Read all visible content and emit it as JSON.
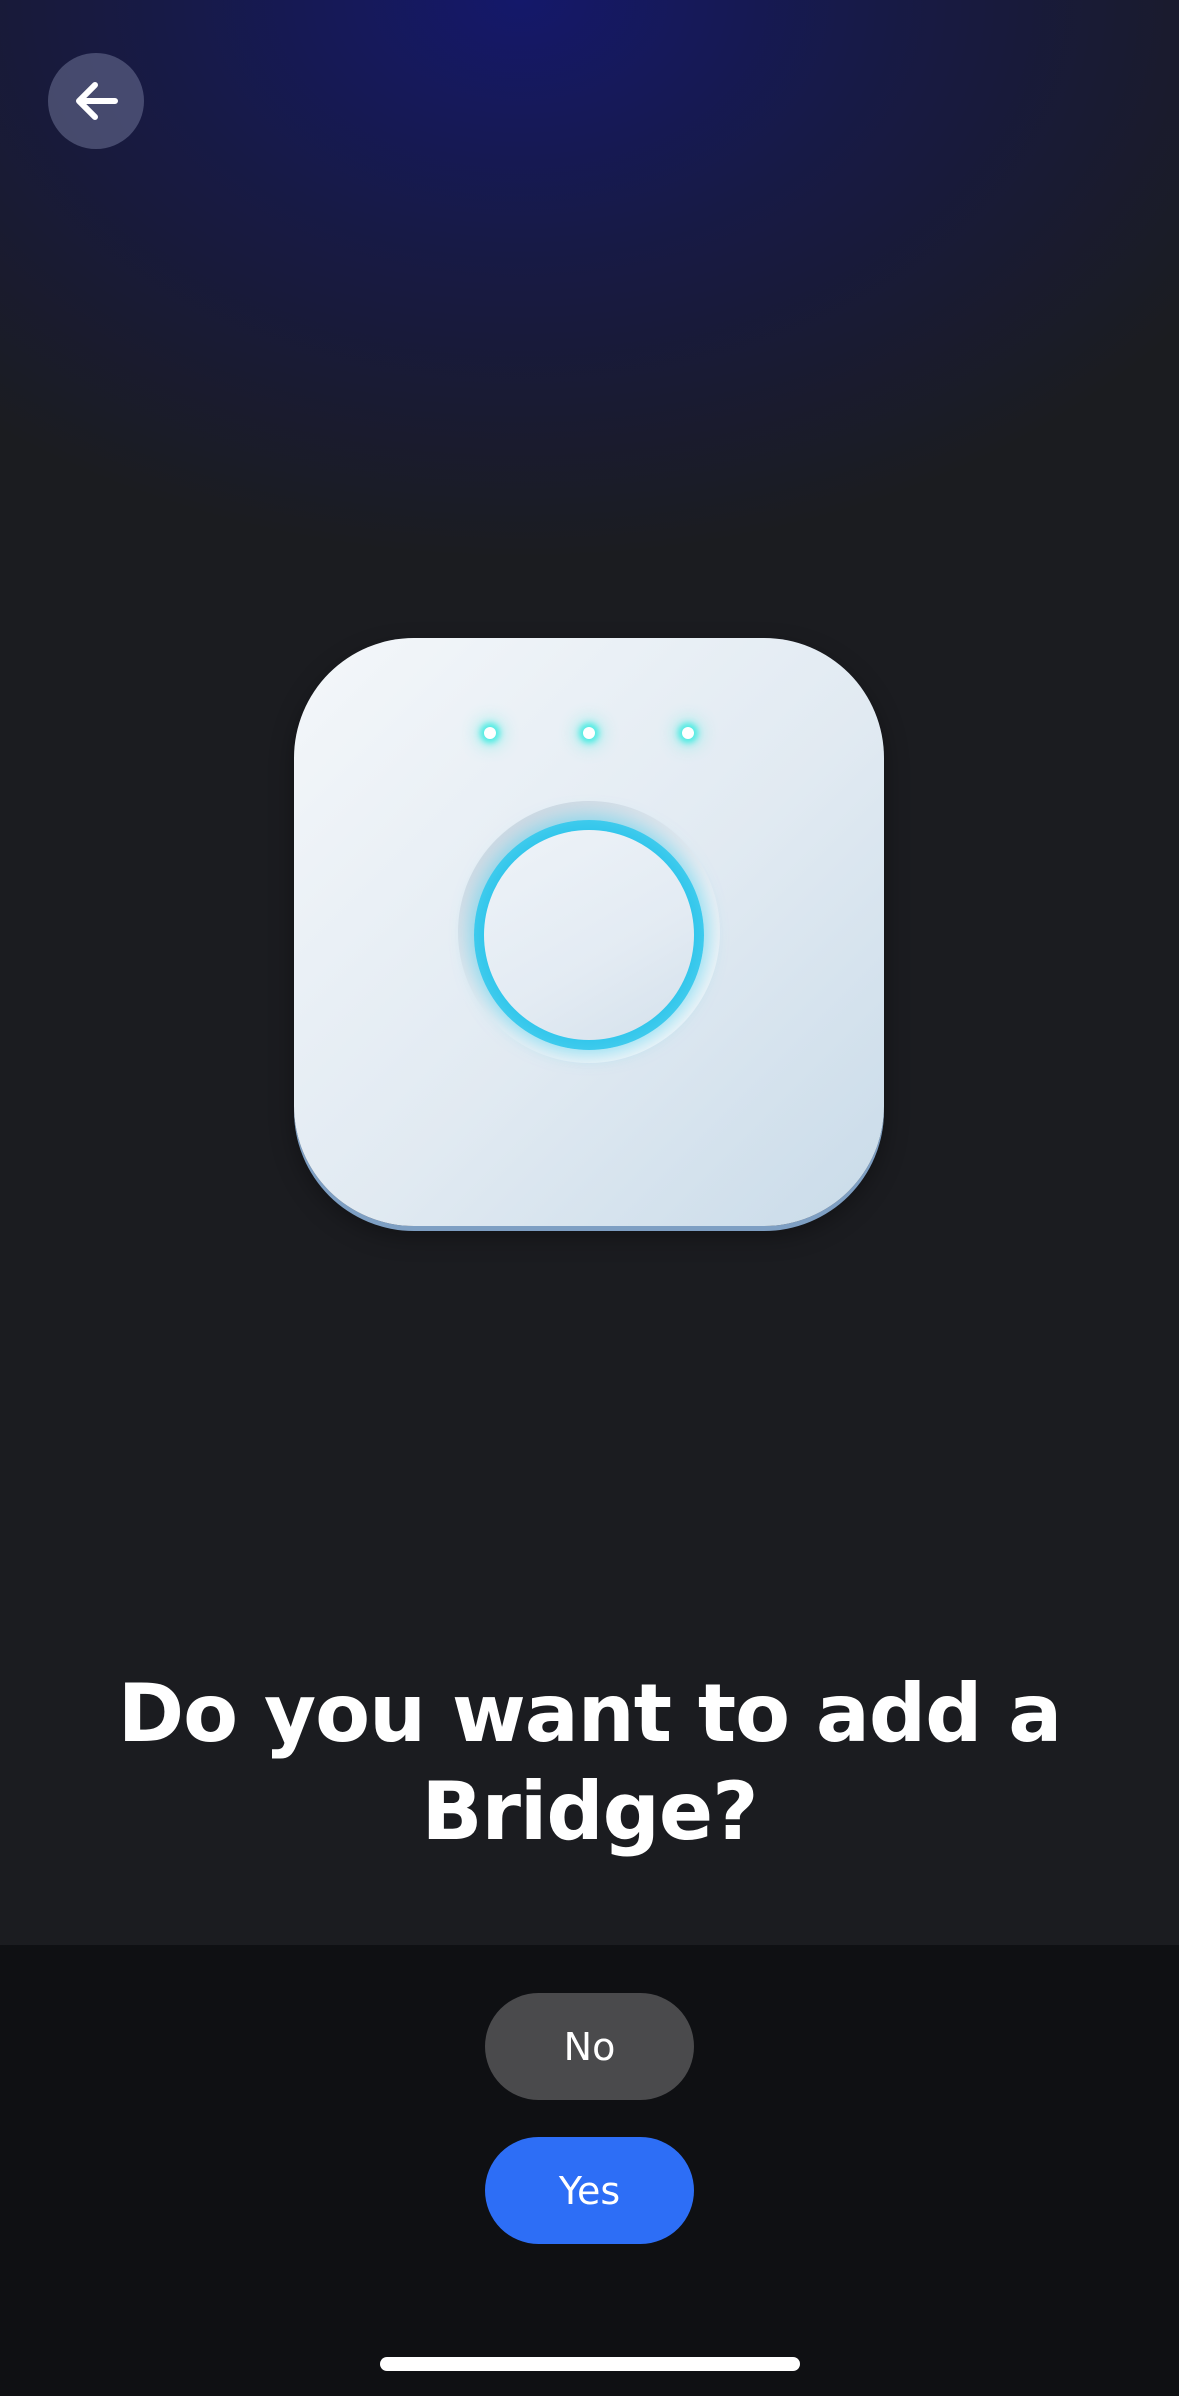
{
  "header": {
    "back_icon": "arrow-left-icon"
  },
  "illustration": {
    "device_icon": "hue-bridge-icon",
    "led_color": "#46ebe1",
    "ring_color": "#2cc4ea"
  },
  "prompt": {
    "title": "Do you want to add a Bridge?"
  },
  "actions": {
    "no_label": "No",
    "yes_label": "Yes",
    "yes_color": "#2d6ef6",
    "no_color": "#4a4a4c"
  }
}
